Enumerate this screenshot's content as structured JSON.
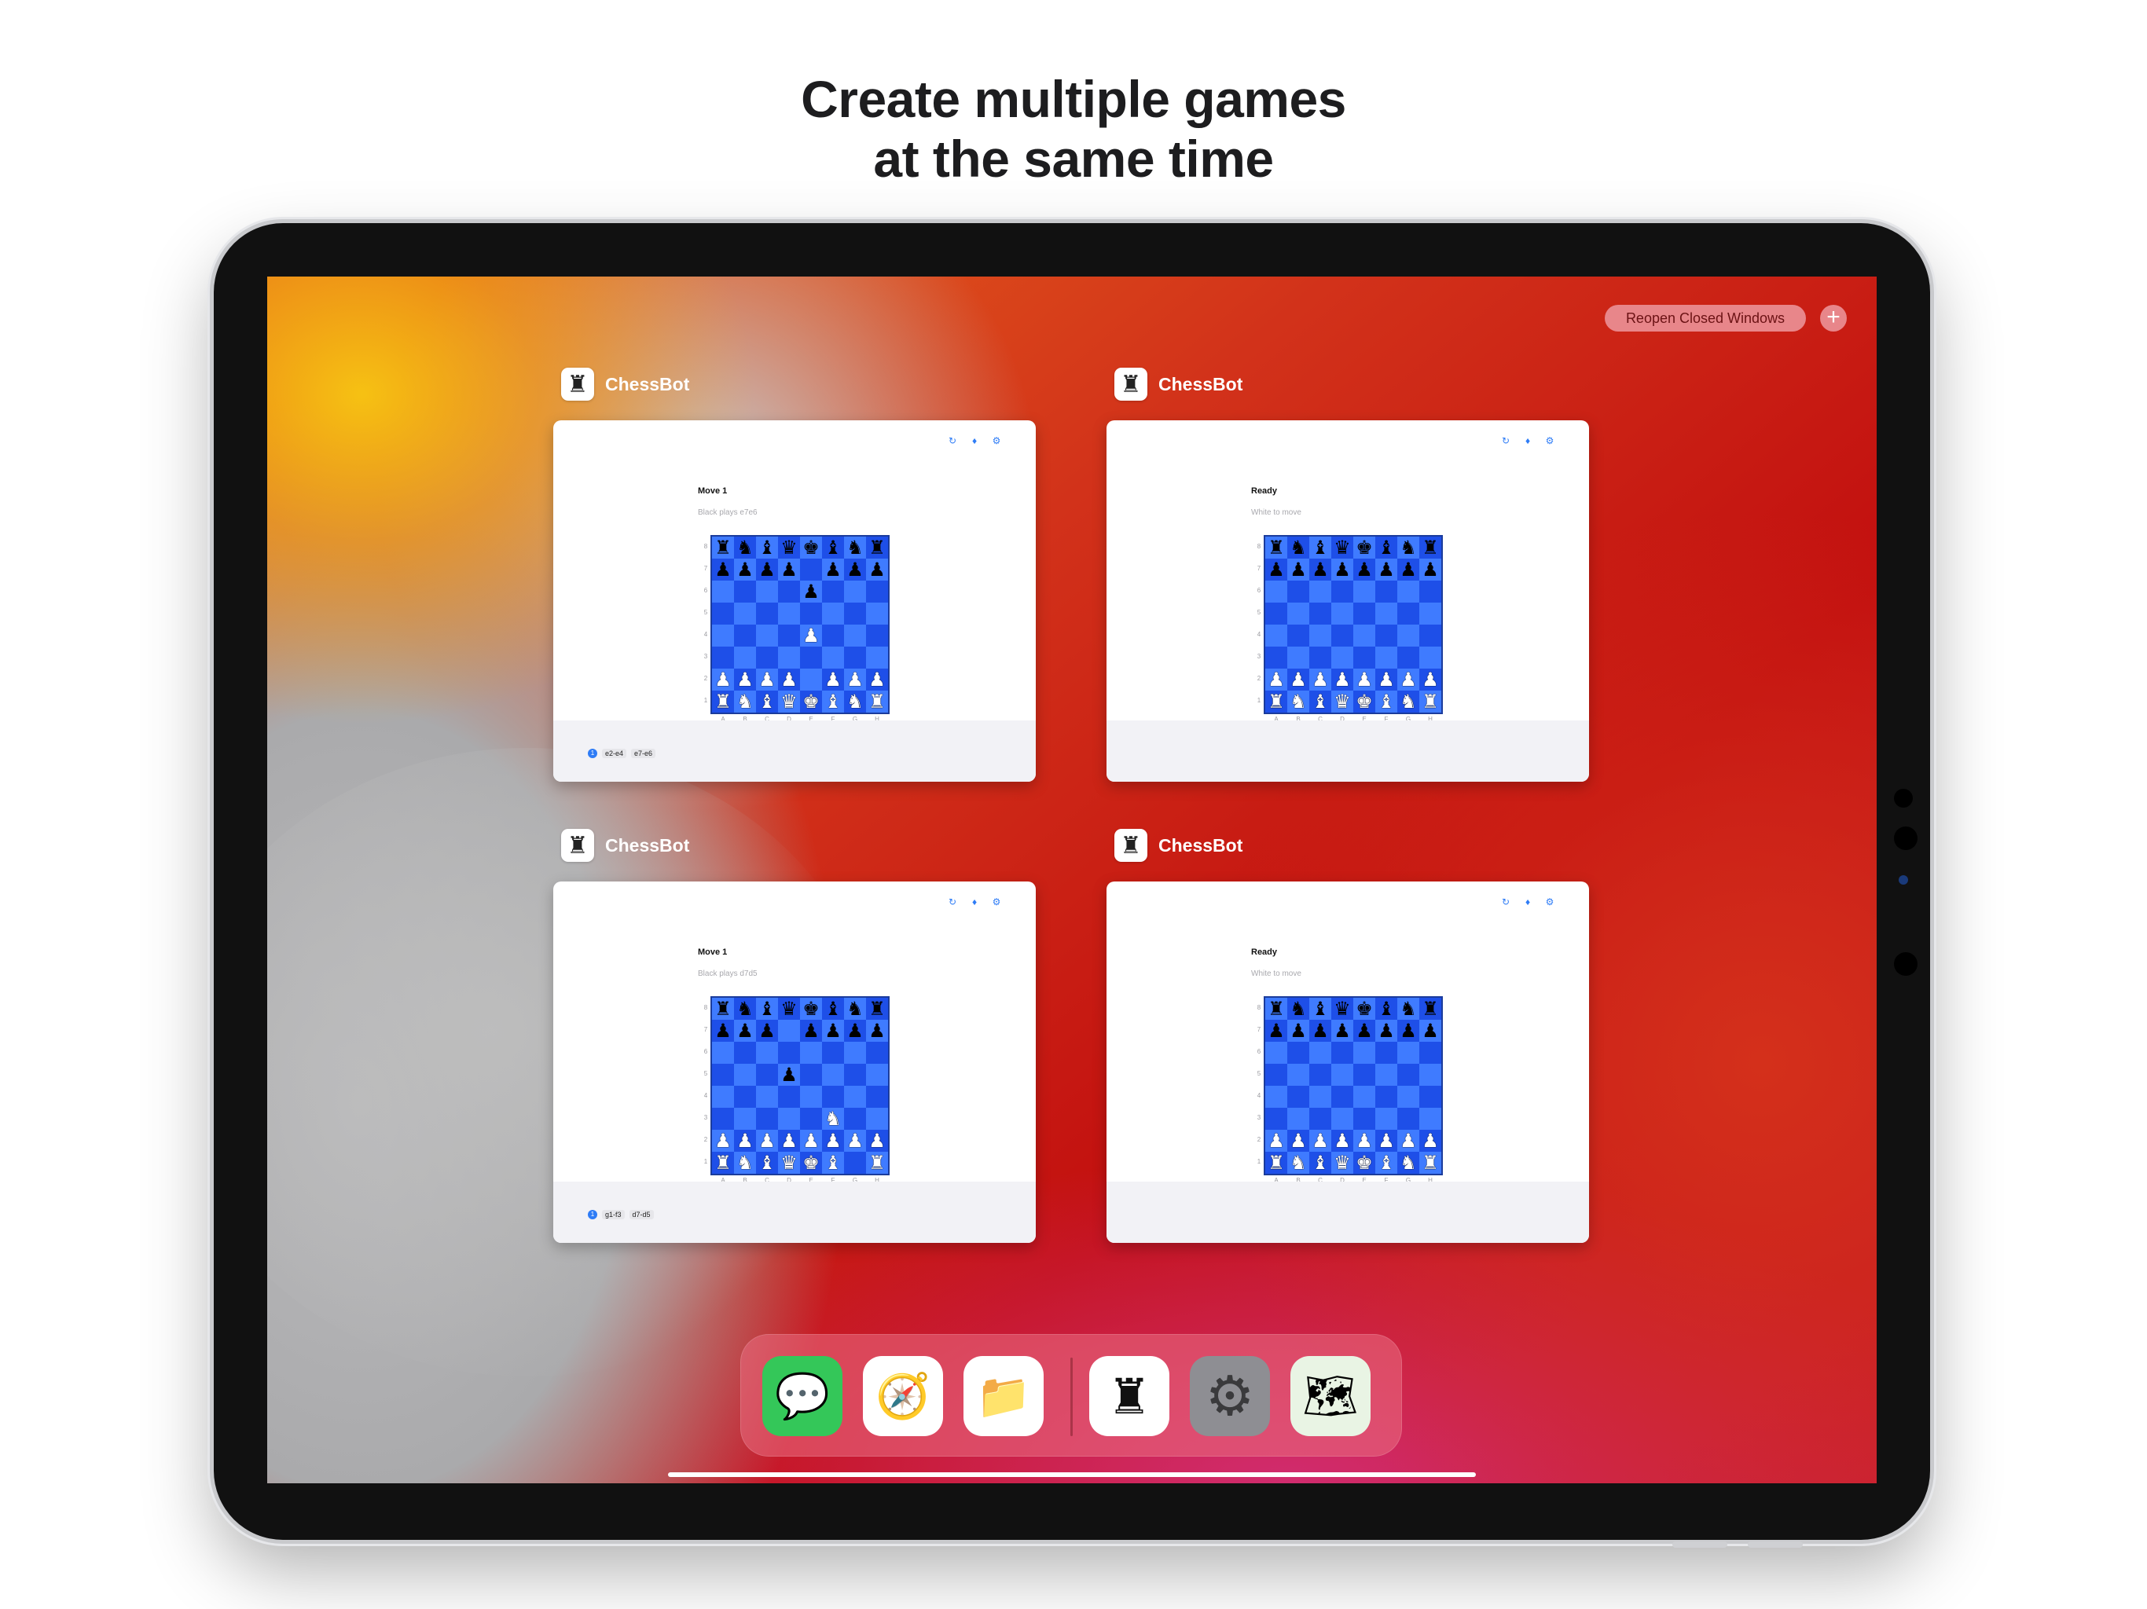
{
  "headline": {
    "line1": "Create multiple games",
    "line2": "at the same time"
  },
  "top_bar": {
    "reopen_label": "Reopen Closed Windows",
    "plus_label": "+"
  },
  "windows": [
    {
      "app_name": "ChessBot",
      "status_title": "Move 1",
      "status_sub": "Black plays e7e6",
      "moves": [
        "e2-e4",
        "e7-e6"
      ],
      "board": [
        "rnbqkbnr",
        "pppp.ppp",
        "....p...",
        "........",
        "....P...",
        "........",
        "PPPP.PPP",
        "RNBQKBNR"
      ]
    },
    {
      "app_name": "ChessBot",
      "status_title": "Ready",
      "status_sub": "White to move",
      "moves": [],
      "board": [
        "rnbqkbnr",
        "pppppppp",
        "........",
        "........",
        "........",
        "........",
        "PPPPPPPP",
        "RNBQKBNR"
      ]
    },
    {
      "app_name": "ChessBot",
      "status_title": "Move 1",
      "status_sub": "Black plays d7d5",
      "moves": [
        "g1-f3",
        "d7-d5"
      ],
      "board": [
        "rnbqkbnr",
        "ppp.pppp",
        "........",
        "...p....",
        "........",
        ".....N..",
        "PPPPPPPP",
        "RNBQKB.R"
      ]
    },
    {
      "app_name": "ChessBot",
      "status_title": "Ready",
      "status_sub": "White to move",
      "moves": [],
      "board": [
        "rnbqkbnr",
        "pppppppp",
        "........",
        "........",
        "........",
        "........",
        "PPPPPPPP",
        "RNBQKBNR"
      ]
    }
  ],
  "board_files": [
    "A",
    "B",
    "C",
    "D",
    "E",
    "F",
    "G",
    "H"
  ],
  "board_ranks": [
    "8",
    "7",
    "6",
    "5",
    "4",
    "3",
    "2",
    "1"
  ],
  "dock": [
    {
      "name": "messages-icon",
      "bg": "#34c759",
      "glyph": "💬"
    },
    {
      "name": "safari-icon",
      "bg": "#ffffff",
      "glyph": "🧭"
    },
    {
      "name": "files-icon",
      "bg": "#ffffff",
      "glyph": "📁"
    },
    {
      "name": "chessbot-icon",
      "bg": "#ffffff",
      "glyph": "♜"
    },
    {
      "name": "settings-icon",
      "bg": "#8e8e93",
      "glyph": "⚙"
    },
    {
      "name": "maps-icon",
      "bg": "#e9f4e4",
      "glyph": "🗺"
    }
  ],
  "colors": {
    "board_light": "#3f7bff",
    "board_dark": "#1e4fe8",
    "accent": "#2e7cf6"
  }
}
